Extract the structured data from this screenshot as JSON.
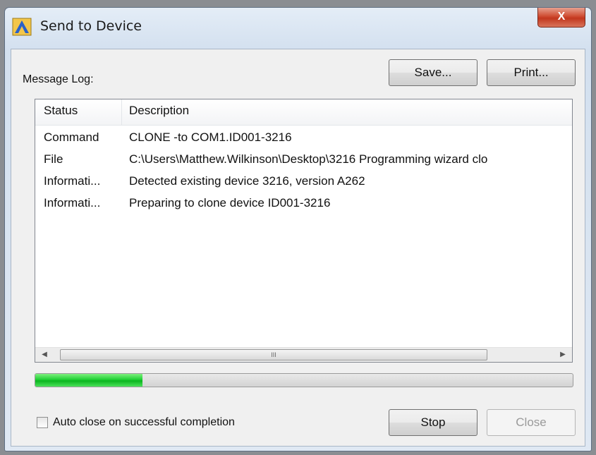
{
  "window": {
    "title": "Send to Device",
    "close_glyph": "X"
  },
  "message_log": {
    "label": "Message Log:"
  },
  "buttons": {
    "save": "Save...",
    "print": "Print...",
    "stop": "Stop",
    "close": "Close"
  },
  "log": {
    "columns": [
      "Status",
      "Description"
    ],
    "rows": [
      {
        "status": "Command",
        "description": "CLONE -to COM1.ID001-3216"
      },
      {
        "status": "File",
        "description": "C:\\Users\\Matthew.Wilkinson\\Desktop\\3216 Programming wizard clo"
      },
      {
        "status": "Informati...",
        "description": "Detected existing device 3216, version A262"
      },
      {
        "status": "Informati...",
        "description": "Preparing to clone device ID001-3216"
      }
    ]
  },
  "scrollbar": {
    "left_arrow": "◀",
    "right_arrow": "▶",
    "grip": "III"
  },
  "progress": {
    "fraction": 0.2
  },
  "auto_close": {
    "label": "Auto close on successful completion",
    "checked": false
  },
  "icons": {
    "app": "device-app-icon",
    "close": "close-icon"
  },
  "colors": {
    "progress_green": "#1fcf34",
    "close_button_red": "#c2371e"
  }
}
